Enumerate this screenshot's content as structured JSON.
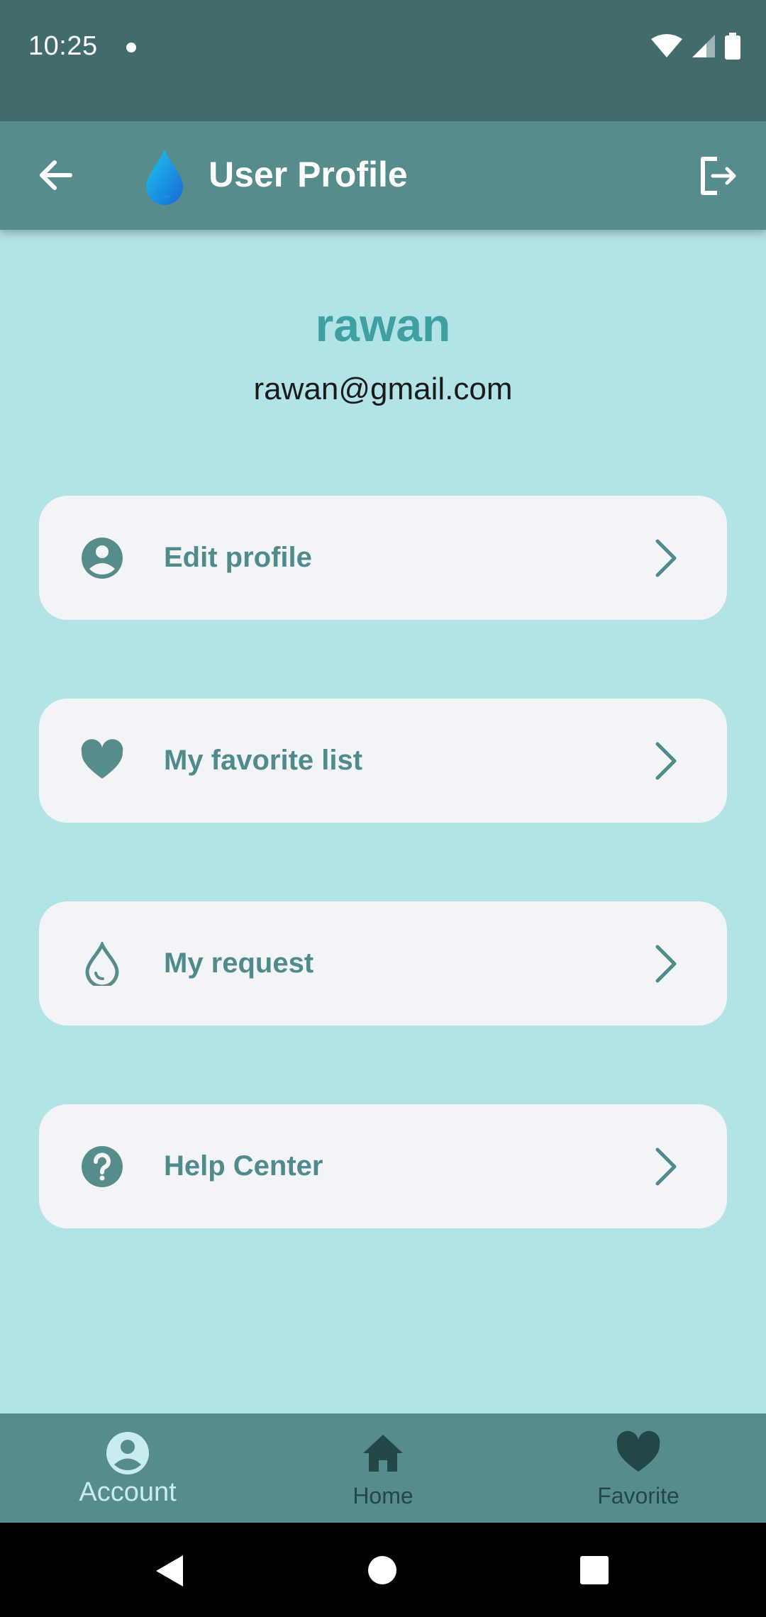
{
  "status_bar": {
    "time": "10:25"
  },
  "app_bar": {
    "title": "User Profile"
  },
  "profile": {
    "name": "rawan",
    "email": "rawan@gmail.com"
  },
  "menu": [
    {
      "label": "Edit profile",
      "icon": "account-circle-icon"
    },
    {
      "label": "My favorite list",
      "icon": "heart-icon"
    },
    {
      "label": "My request",
      "icon": "water-drop-icon"
    },
    {
      "label": "Help Center",
      "icon": "help-circle-icon"
    }
  ],
  "bottom_nav": [
    {
      "label": "Account",
      "icon": "account-circle-icon",
      "active": true
    },
    {
      "label": "Home",
      "icon": "home-icon",
      "active": false
    },
    {
      "label": "Favorite",
      "icon": "heart-icon",
      "active": false
    }
  ],
  "colors": {
    "status_bar": "#426b6b",
    "app_bar": "#578c8d",
    "background": "#b2e3e6",
    "card": "#f3f4f8",
    "accent": "#3fa0a2",
    "menu_text": "#4f8a8c"
  }
}
